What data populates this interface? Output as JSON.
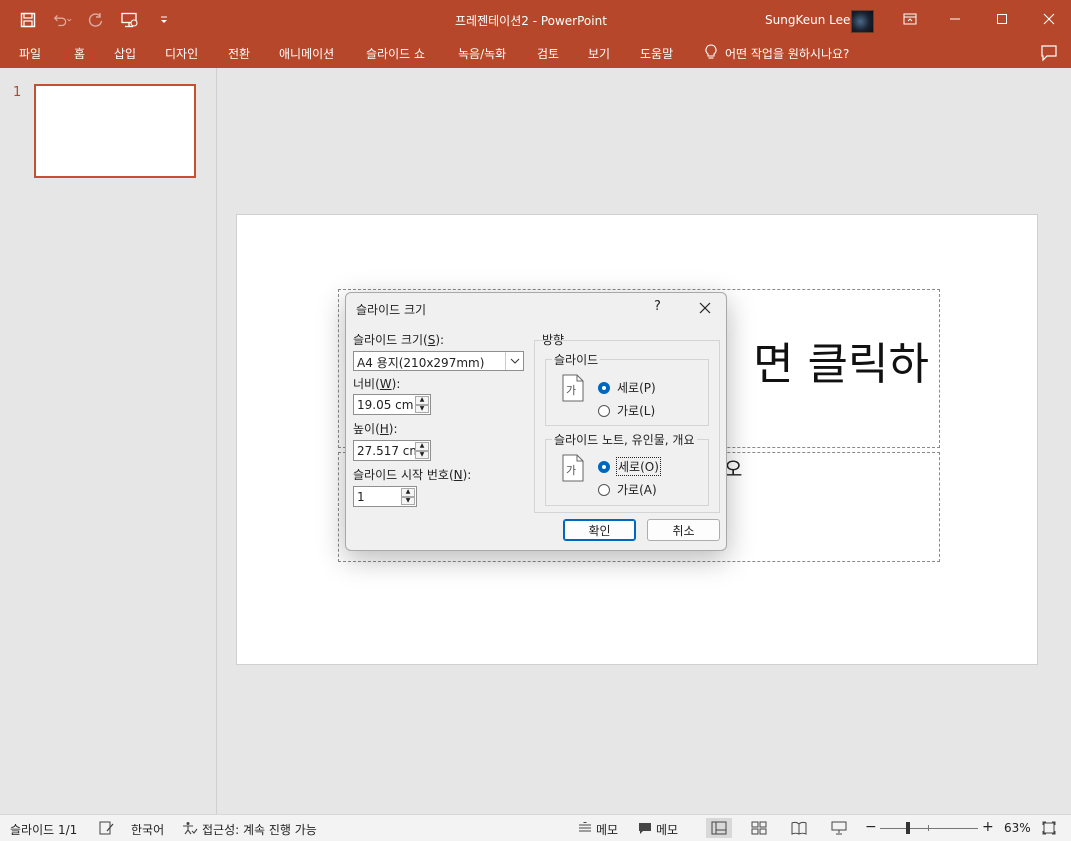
{
  "window": {
    "title": "프레젠테이션2  -  PowerPoint",
    "user_name": "SungKeun Lee",
    "accent_color": "#b7472a"
  },
  "qat": {
    "icons": [
      "save-icon",
      "undo-icon",
      "redo-icon",
      "present-from-start-icon",
      "customize-qat-icon"
    ]
  },
  "ribbon": {
    "tabs": [
      "파일",
      "홈",
      "삽입",
      "디자인",
      "전환",
      "애니메이션",
      "슬라이드 쇼",
      "녹음/녹화",
      "검토",
      "보기",
      "도움말"
    ],
    "tell_me": "어떤 작업을 원하시나요?"
  },
  "thumbnails": {
    "items": [
      {
        "number": "1"
      }
    ]
  },
  "slide": {
    "title_placeholder_visible_text": "면 클릭하",
    "subtitle_placeholder_visible_text": "오"
  },
  "dialog": {
    "title": "슬라이드 크기",
    "help": "?",
    "slide_size_label": "슬라이드 크기(",
    "slide_size_key": "S",
    "slide_size_value": "A4 용지(210x297mm)",
    "width_label": "너비(",
    "width_key": "W",
    "width_value": "19.05 cm",
    "height_label": "높이(",
    "height_key": "H",
    "height_value": "27.517 cm",
    "start_number_label": "슬라이드 시작 번호(",
    "start_number_key": "N",
    "start_number_value": "1",
    "orientation_label": "방향",
    "slides_group_label": "슬라이드",
    "slides_portrait": "세로(P)",
    "slides_landscape": "가로(L)",
    "slides_selected": "portrait",
    "notes_group_label": "슬라이드 노트, 유인물, 개요",
    "notes_portrait": "세로(O)",
    "notes_landscape": "가로(A)",
    "notes_selected": "portrait",
    "ok_label": "확인",
    "cancel_label": "취소"
  },
  "statusbar": {
    "slide_count": "슬라이드 1/1",
    "language": "한국어",
    "accessibility": "접근성: 계속 진행 가능",
    "notes": "메모",
    "comments": "메모",
    "zoom": "63%"
  }
}
